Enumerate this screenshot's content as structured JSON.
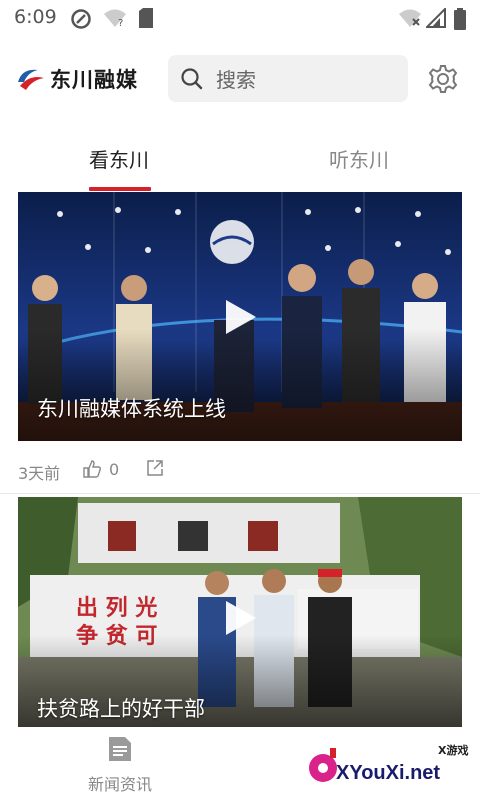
{
  "status_bar": {
    "time": "6:09"
  },
  "header": {
    "brand": "东川融媒",
    "search": {
      "placeholder": "搜索"
    }
  },
  "tabs": [
    {
      "label": "看东川",
      "active": true
    },
    {
      "label": "听东川",
      "active": false
    }
  ],
  "feed": [
    {
      "caption": "东川融媒体系统上线",
      "time_ago": "3天前",
      "likes": "0"
    },
    {
      "caption": "扶贫路上的好干部"
    }
  ],
  "bottom_nav": [
    {
      "label": "新闻资讯",
      "icon": "news-doc-icon"
    }
  ],
  "watermark": {
    "badge": "X游戏",
    "site": "XYouXi.net"
  },
  "colors": {
    "accent": "#d5222a",
    "logo_blue": "#1f5fa8"
  }
}
